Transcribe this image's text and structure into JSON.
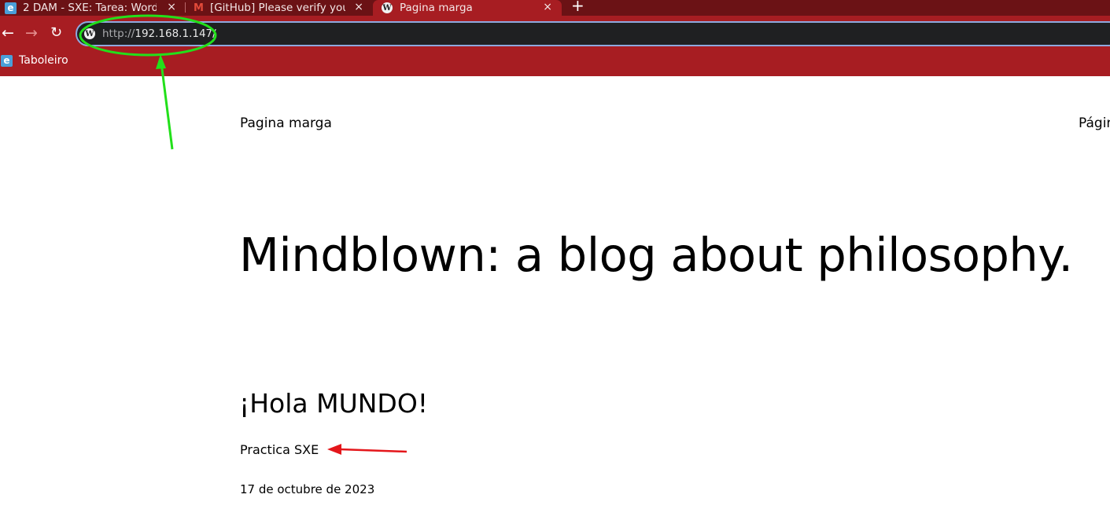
{
  "browser": {
    "tabs": [
      {
        "title": "2 DAM - SXE: Tarea: Word",
        "icon": "edumoodle-icon",
        "active": false
      },
      {
        "title": "[GitHub] Please verify you",
        "icon": "gmail-icon",
        "active": false
      },
      {
        "title": "Pagina marga",
        "icon": "wordpress-icon",
        "active": true
      }
    ],
    "tab_close_glyph": "×",
    "new_tab_glyph": "+",
    "address": {
      "scheme": "http://",
      "host": "192.168.1.147/"
    },
    "bookmarks": [
      {
        "label": "Taboleiro",
        "icon": "edumoodle-icon"
      }
    ]
  },
  "site": {
    "title": "Pagina marga",
    "nav_partial": "Págin",
    "hero": "Mindblown: a blog about philosophy."
  },
  "post": {
    "title": "¡Hola MUNDO!",
    "excerpt": "Practica SXE",
    "date": "17 de octubre de 2023"
  },
  "colors": {
    "tabbar": "#6b1215",
    "toolbar": "#a71d22",
    "omnibox": "#1f2022",
    "annotation_green": "#22e01a",
    "annotation_red": "#e4161b"
  }
}
